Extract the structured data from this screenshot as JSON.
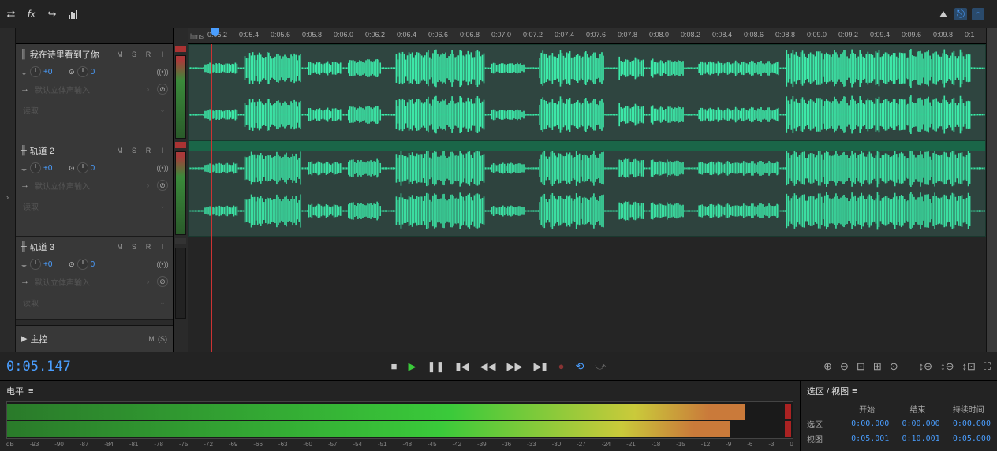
{
  "toolbar": {
    "icons": [
      "swap-icon",
      "fx-icon",
      "send-icon",
      "bars-icon",
      "triangle-icon",
      "snap-icon",
      "magnet-icon"
    ]
  },
  "ruler": {
    "hms": "hms",
    "ticks": [
      "0:05.2",
      "0:05.4",
      "0:05.6",
      "0:05.8",
      "0:06.0",
      "0:06.2",
      "0:06.4",
      "0:06.6",
      "0:06.8",
      "0:07.0",
      "0:07.2",
      "0:07.4",
      "0:07.6",
      "0:07.8",
      "0:08.0",
      "0:08.2",
      "0:08.4",
      "0:08.6",
      "0:08.8",
      "0:09.0",
      "0:09.2",
      "0:09.4",
      "0:09.6",
      "0:09.8",
      "0:1"
    ]
  },
  "tracks": [
    {
      "name": "我在诗里看到了你",
      "m": "M",
      "s": "S",
      "r": "R",
      "i": "I",
      "vol": "+0",
      "pan": "0",
      "input": "默认立体声输入",
      "read": "读取"
    },
    {
      "name": "轨道 2",
      "m": "M",
      "s": "S",
      "r": "R",
      "i": "I",
      "vol": "+0",
      "pan": "0",
      "input": "默认立体声输入",
      "read": "读取"
    },
    {
      "name": "轨道 3",
      "m": "M",
      "s": "S",
      "r": "R",
      "i": "I",
      "vol": "+0",
      "pan": "0",
      "input": "默认立体声输入",
      "read": "读取"
    }
  ],
  "master": {
    "name": "主控",
    "m": "M",
    "s": "(S)"
  },
  "timecode": "0:05.147",
  "levels": {
    "title": "电平"
  },
  "db_scale": [
    "dB",
    "-93",
    "-90",
    "-87",
    "-84",
    "-81",
    "-78",
    "-75",
    "-72",
    "-69",
    "-66",
    "-63",
    "-60",
    "-57",
    "-54",
    "-51",
    "-48",
    "-45",
    "-42",
    "-39",
    "-36",
    "-33",
    "-30",
    "-27",
    "-24",
    "-21",
    "-18",
    "-15",
    "-12",
    "-9",
    "-6",
    "-3",
    "0"
  ],
  "selection": {
    "title": "选区 / 视图",
    "start": "开始",
    "end": "结束",
    "duration": "持续时间",
    "sel_label": "选区",
    "view_label": "视图",
    "sel_start": "0:00.000",
    "sel_end": "0:00.000",
    "sel_dur": "0:00.000",
    "view_start": "0:05.001",
    "view_end": "0:10.001",
    "view_dur": "0:05.000"
  },
  "right_icon": "≡"
}
